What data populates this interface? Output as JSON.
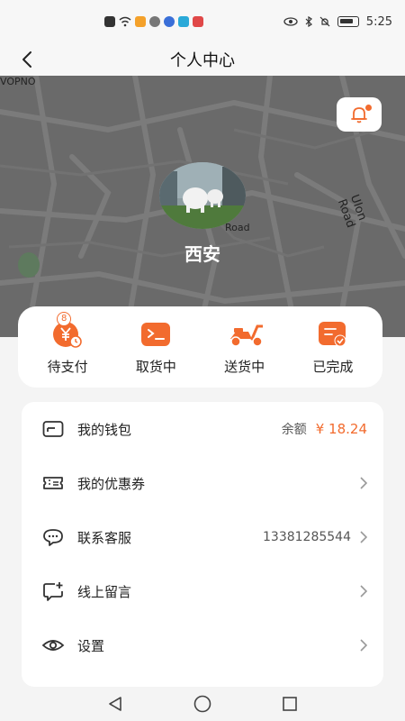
{
  "status_bar": {
    "time": "5:25",
    "left_icons": [
      "alert-icon",
      "wifi-icon",
      "app-icon-orange",
      "app-icon-gray",
      "app-icon-blue",
      "app-icon-teal",
      "app-icon-red"
    ],
    "right_icons": [
      "eye-icon",
      "bluetooth-icon",
      "mute-icon",
      "battery-icon"
    ]
  },
  "nav": {
    "title": "个人中心",
    "back_icon": "chevron-left-icon"
  },
  "map": {
    "label_topleft": "VOPNO",
    "label_road": "Ulon Road",
    "label_road_small": "Road"
  },
  "profile": {
    "city": "西安",
    "avatar_icon": "avatar-photo"
  },
  "orders": [
    {
      "label": "待支付",
      "icon": "yen-clock-icon",
      "badge": "8"
    },
    {
      "label": "取货中",
      "icon": "terminal-box-icon"
    },
    {
      "label": "送货中",
      "icon": "scooter-icon"
    },
    {
      "label": "已完成",
      "icon": "check-document-icon"
    }
  ],
  "menu": {
    "wallet": {
      "label": "我的钱包",
      "icon": "wallet-icon",
      "balance_label": "余额",
      "balance_value": "¥ 18.24"
    },
    "coupons": {
      "label": "我的优惠券",
      "icon": "ticket-icon"
    },
    "service": {
      "label": "联系客服",
      "icon": "chat-bubble-icon",
      "phone": "13381285544"
    },
    "message": {
      "label": "线上留言",
      "icon": "message-add-icon"
    },
    "settings": {
      "label": "设置",
      "icon": "eye-settings-icon"
    }
  },
  "colors": {
    "accent": "#f26b2e",
    "map_bg": "#6a6a6a",
    "page_bg": "#f4f4f4"
  }
}
